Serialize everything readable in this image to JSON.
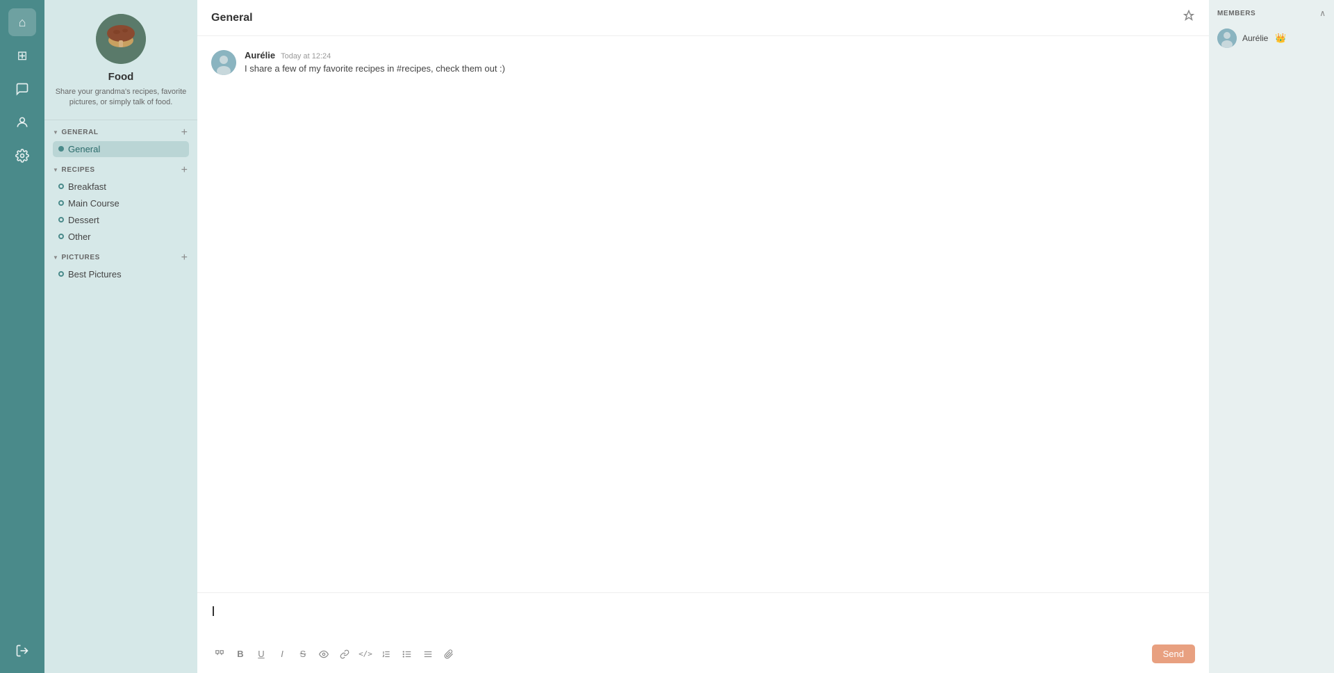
{
  "nav": {
    "icons": [
      {
        "name": "home-icon",
        "symbol": "⌂"
      },
      {
        "name": "grid-icon",
        "symbol": "⊞"
      },
      {
        "name": "chat-icon",
        "symbol": "💬"
      },
      {
        "name": "user-icon",
        "symbol": "👤"
      },
      {
        "name": "settings-icon",
        "symbol": "⚙"
      }
    ],
    "bottom_icons": [
      {
        "name": "logout-icon",
        "symbol": "⬚"
      }
    ]
  },
  "sidebar": {
    "community_name": "Food",
    "community_desc": "Share your grandma's recipes, favorite pictures, or simply talk of food.",
    "sections": [
      {
        "key": "general",
        "title": "GENERAL",
        "channels": [
          {
            "name": "General",
            "active": true,
            "dot": "filled"
          }
        ]
      },
      {
        "key": "recipes",
        "title": "RECIPES",
        "channels": [
          {
            "name": "Breakfast",
            "active": false,
            "dot": "filled"
          },
          {
            "name": "Main Course",
            "active": false,
            "dot": "filled"
          },
          {
            "name": "Dessert",
            "active": false,
            "dot": "filled"
          },
          {
            "name": "Other",
            "active": false,
            "dot": "filled"
          }
        ]
      },
      {
        "key": "pictures",
        "title": "PICTURES",
        "channels": [
          {
            "name": "Best Pictures",
            "active": false,
            "dot": "filled"
          }
        ]
      }
    ]
  },
  "channel": {
    "name": "General",
    "pin_title": "Pinned messages"
  },
  "messages": [
    {
      "author": "Aurélie",
      "time": "Today at 12:24",
      "text": "I share a few of my favorite recipes in #recipes, check them out :)"
    }
  ],
  "editor": {
    "placeholder": "",
    "send_label": "Send"
  },
  "toolbar": {
    "icons": [
      {
        "name": "block-quote-icon",
        "symbol": "❝"
      },
      {
        "name": "bold-icon",
        "symbol": "B"
      },
      {
        "name": "underline-icon",
        "symbol": "U"
      },
      {
        "name": "italic-icon",
        "symbol": "I"
      },
      {
        "name": "strikethrough-icon",
        "symbol": "S̶"
      },
      {
        "name": "spoiler-icon",
        "symbol": "◉"
      },
      {
        "name": "link-icon",
        "symbol": "🔗"
      },
      {
        "name": "code-icon",
        "symbol": "</>"
      },
      {
        "name": "ordered-list-icon",
        "symbol": "≡"
      },
      {
        "name": "unordered-list-icon",
        "symbol": "☰"
      },
      {
        "name": "indent-icon",
        "symbol": "⇥"
      },
      {
        "name": "attachment-icon",
        "symbol": "📎"
      }
    ]
  },
  "members": {
    "title": "MEMBERS",
    "items": [
      {
        "name": "Aurélie",
        "crown": true
      }
    ]
  }
}
